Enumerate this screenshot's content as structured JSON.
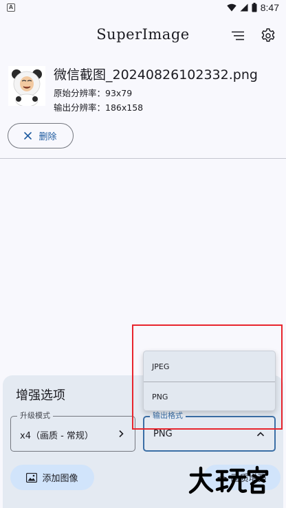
{
  "status_bar": {
    "app_icon_letter": "A",
    "time": "8:47"
  },
  "header": {
    "title": "SuperImage",
    "menu_icon": "menu-lines-icon",
    "settings_icon": "gear-icon"
  },
  "file": {
    "name": "微信截图_20240826102332.png",
    "original_resolution": "原始分辨率：93x79",
    "output_resolution": "输出分辨率：186x158"
  },
  "delete_button": {
    "label": "删除",
    "icon": "close-icon"
  },
  "options": {
    "title": "增强选项",
    "upgrade_mode": {
      "label": "升级模式",
      "value": "x4（画质 - 常规）"
    },
    "output_format": {
      "label": "输出格式",
      "value": "PNG",
      "options": [
        "JPEG",
        "PNG"
      ]
    },
    "add_image_button": "添加图像",
    "enhance_button": "画质增强"
  },
  "watermark": {
    "text": "大玩家"
  },
  "colors": {
    "accent": "#3a6ea5",
    "highlight": "#e8242c",
    "panel": "#e4eaf2",
    "button": "#d1e4fb"
  }
}
